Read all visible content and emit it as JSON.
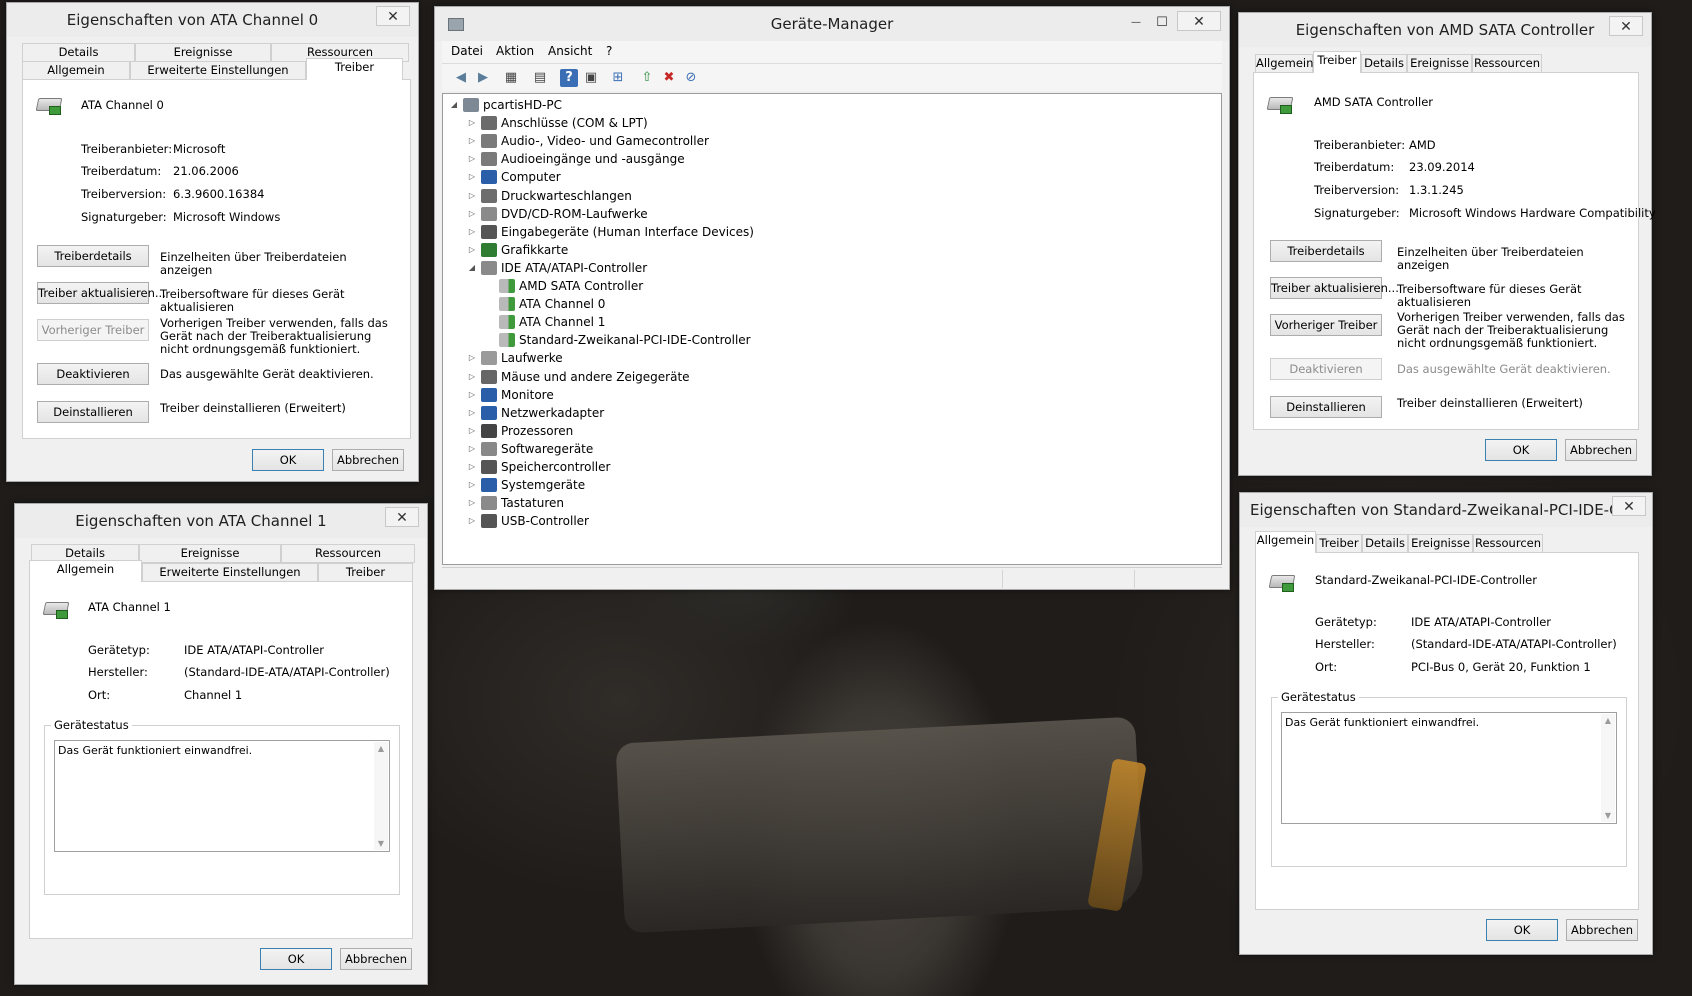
{
  "device_manager": {
    "title": "Geräte-Manager",
    "menu": [
      "Datei",
      "Aktion",
      "Ansicht",
      "?"
    ],
    "toolbar_icons": [
      "back-icon",
      "forward-icon",
      "properties-grid-icon",
      "console-icon",
      "help-icon",
      "view-icon",
      "scan-icon",
      "update-driver-icon",
      "uninstall-icon",
      "disable-icon"
    ],
    "root": "pcartisHD-PC",
    "categories": [
      {
        "label": "Anschlüsse (COM & LPT)",
        "icon": "port-icon",
        "color": "#6b6b6b"
      },
      {
        "label": "Audio-, Video- und Gamecontroller",
        "icon": "speaker-icon",
        "color": "#7a7a7a"
      },
      {
        "label": "Audioeingänge und -ausgänge",
        "icon": "speaker-icon",
        "color": "#7a7a7a"
      },
      {
        "label": "Computer",
        "icon": "computer-icon",
        "color": "#2a5ea8"
      },
      {
        "label": "Druckwarteschlangen",
        "icon": "printer-icon",
        "color": "#6d6d6d"
      },
      {
        "label": "DVD/CD-ROM-Laufwerke",
        "icon": "disc-drive-icon",
        "color": "#8a8a8a"
      },
      {
        "label": "Eingabegeräte (Human Interface Devices)",
        "icon": "hid-icon",
        "color": "#555555"
      },
      {
        "label": "Grafikkarte",
        "icon": "display-adapter-icon",
        "color": "#2e7d32"
      },
      {
        "label": "IDE ATA/ATAPI-Controller",
        "icon": "ide-controller-icon",
        "color": "#8a8a8a",
        "expanded": true,
        "children": [
          "AMD SATA Controller",
          "ATA Channel 0",
          "ATA Channel 1",
          "Standard-Zweikanal-PCI-IDE-Controller"
        ]
      },
      {
        "label": "Laufwerke",
        "icon": "disk-drive-icon",
        "color": "#9a9a9a"
      },
      {
        "label": "Mäuse und andere Zeigegeräte",
        "icon": "mouse-icon",
        "color": "#666666"
      },
      {
        "label": "Monitore",
        "icon": "monitor-icon",
        "color": "#2a5ea8"
      },
      {
        "label": "Netzwerkadapter",
        "icon": "network-icon",
        "color": "#2a5ea8"
      },
      {
        "label": "Prozessoren",
        "icon": "processor-icon",
        "color": "#444444"
      },
      {
        "label": "Softwaregeräte",
        "icon": "software-device-icon",
        "color": "#888888"
      },
      {
        "label": "Speichercontroller",
        "icon": "storage-controller-icon",
        "color": "#555555"
      },
      {
        "label": "Systemgeräte",
        "icon": "system-device-icon",
        "color": "#2a5ea8"
      },
      {
        "label": "Tastaturen",
        "icon": "keyboard-icon",
        "color": "#8a8a8a"
      },
      {
        "label": "USB-Controller",
        "icon": "usb-icon",
        "color": "#555555"
      }
    ]
  },
  "ata0": {
    "title": "Eigenschaften von ATA Channel 0",
    "tabs_back": [
      "Details",
      "Ereignisse",
      "Ressourcen"
    ],
    "tabs_front": [
      "Allgemein",
      "Erweiterte Einstellungen",
      "Treiber"
    ],
    "device": "ATA Channel 0",
    "fields": [
      {
        "label": "Treiberanbieter:",
        "value": "Microsoft"
      },
      {
        "label": "Treiberdatum:",
        "value": "21.06.2006"
      },
      {
        "label": "Treiberversion:",
        "value": "6.3.9600.16384"
      },
      {
        "label": "Signaturgeber:",
        "value": "Microsoft Windows"
      }
    ],
    "actions": [
      {
        "button": "Treiberdetails",
        "desc": "Einzelheiten über Treiberdateien anzeigen",
        "disabled": false
      },
      {
        "button": "Treiber aktualisieren...",
        "desc": "Treibersoftware für dieses Gerät aktualisieren",
        "disabled": false
      },
      {
        "button": "Vorheriger Treiber",
        "desc": "Vorherigen Treiber verwenden, falls das Gerät nach der Treiberaktualisierung nicht ordnungsgemäß funktioniert.",
        "disabled": true
      },
      {
        "button": "Deaktivieren",
        "desc": "Das ausgewählte Gerät deaktivieren.",
        "disabled": false
      },
      {
        "button": "Deinstallieren",
        "desc": "Treiber deinstallieren (Erweitert)",
        "disabled": false
      }
    ],
    "ok": "OK",
    "cancel": "Abbrechen"
  },
  "ata1": {
    "title": "Eigenschaften von ATA Channel 1",
    "tabs_back": [
      "Details",
      "Ereignisse",
      "Ressourcen"
    ],
    "tabs_front": [
      "Allgemein",
      "Erweiterte Einstellungen",
      "Treiber"
    ],
    "device": "ATA Channel 1",
    "fields": [
      {
        "label": "Gerätetyp:",
        "value": "IDE ATA/ATAPI-Controller"
      },
      {
        "label": "Hersteller:",
        "value": "(Standard-IDE-ATA/ATAPI-Controller)"
      },
      {
        "label": "Ort:",
        "value": "Channel 1"
      }
    ],
    "status_title": "Gerätestatus",
    "status_text": "Das Gerät funktioniert einwandfrei.",
    "ok": "OK",
    "cancel": "Abbrechen"
  },
  "amd": {
    "title": "Eigenschaften von AMD SATA Controller",
    "tabs": [
      "Allgemein",
      "Treiber",
      "Details",
      "Ereignisse",
      "Ressourcen"
    ],
    "device": "AMD SATA Controller",
    "fields": [
      {
        "label": "Treiberanbieter:",
        "value": "AMD"
      },
      {
        "label": "Treiberdatum:",
        "value": "23.09.2014"
      },
      {
        "label": "Treiberversion:",
        "value": "1.3.1.245"
      },
      {
        "label": "Signaturgeber:",
        "value": "Microsoft Windows Hardware Compatibility"
      }
    ],
    "actions": [
      {
        "button": "Treiberdetails",
        "desc": "Einzelheiten über Treiberdateien anzeigen",
        "disabled": false
      },
      {
        "button": "Treiber aktualisieren...",
        "desc": "Treibersoftware für dieses Gerät aktualisieren",
        "disabled": false
      },
      {
        "button": "Vorheriger Treiber",
        "desc": "Vorherigen Treiber verwenden, falls das Gerät nach der Treiberaktualisierung nicht ordnungsgemäß funktioniert.",
        "disabled": false
      },
      {
        "button": "Deaktivieren",
        "desc": "Das ausgewählte Gerät deaktivieren.",
        "disabled": true
      },
      {
        "button": "Deinstallieren",
        "desc": "Treiber deinstallieren (Erweitert)",
        "disabled": false
      }
    ],
    "ok": "OK",
    "cancel": "Abbrechen"
  },
  "pciide": {
    "title": "Eigenschaften von Standard-Zweikanal-PCI-IDE-Contr...",
    "tabs": [
      "Allgemein",
      "Treiber",
      "Details",
      "Ereignisse",
      "Ressourcen"
    ],
    "device": "Standard-Zweikanal-PCI-IDE-Controller",
    "fields": [
      {
        "label": "Gerätetyp:",
        "value": "IDE ATA/ATAPI-Controller"
      },
      {
        "label": "Hersteller:",
        "value": "(Standard-IDE-ATA/ATAPI-Controller)"
      },
      {
        "label": "Ort:",
        "value": "PCI-Bus 0, Gerät 20, Funktion 1"
      }
    ],
    "status_title": "Gerätestatus",
    "status_text": "Das Gerät funktioniert einwandfrei.",
    "ok": "OK",
    "cancel": "Abbrechen"
  },
  "window_controls": {
    "close": "✕",
    "minimize": "—",
    "maximize": "☐"
  }
}
